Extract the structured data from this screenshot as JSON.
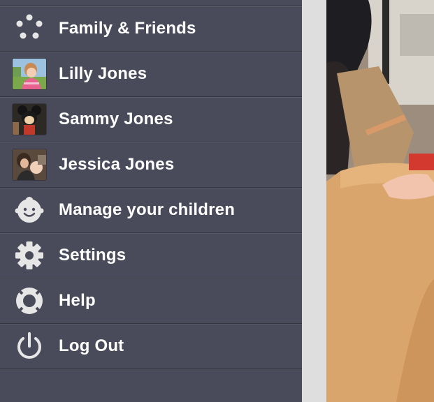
{
  "menu": {
    "items": [
      {
        "label": "Family & Friends",
        "icon": "family-dots-icon"
      },
      {
        "label": "Lilly Jones",
        "icon": "lilly-avatar"
      },
      {
        "label": "Sammy Jones",
        "icon": "sammy-avatar"
      },
      {
        "label": "Jessica Jones",
        "icon": "jessica-avatar"
      },
      {
        "label": "Manage your children",
        "icon": "baby-face-icon"
      },
      {
        "label": "Settings",
        "icon": "gear-icon"
      },
      {
        "label": "Help",
        "icon": "lifebuoy-icon"
      },
      {
        "label": "Log Out",
        "icon": "power-icon"
      }
    ]
  },
  "colors": {
    "drawer_bg": "#4a4b5a",
    "row_divider": "#34353f",
    "label_text": "#ffffff",
    "icon_fill": "#e6e6e6",
    "gutter": "#dedede"
  }
}
